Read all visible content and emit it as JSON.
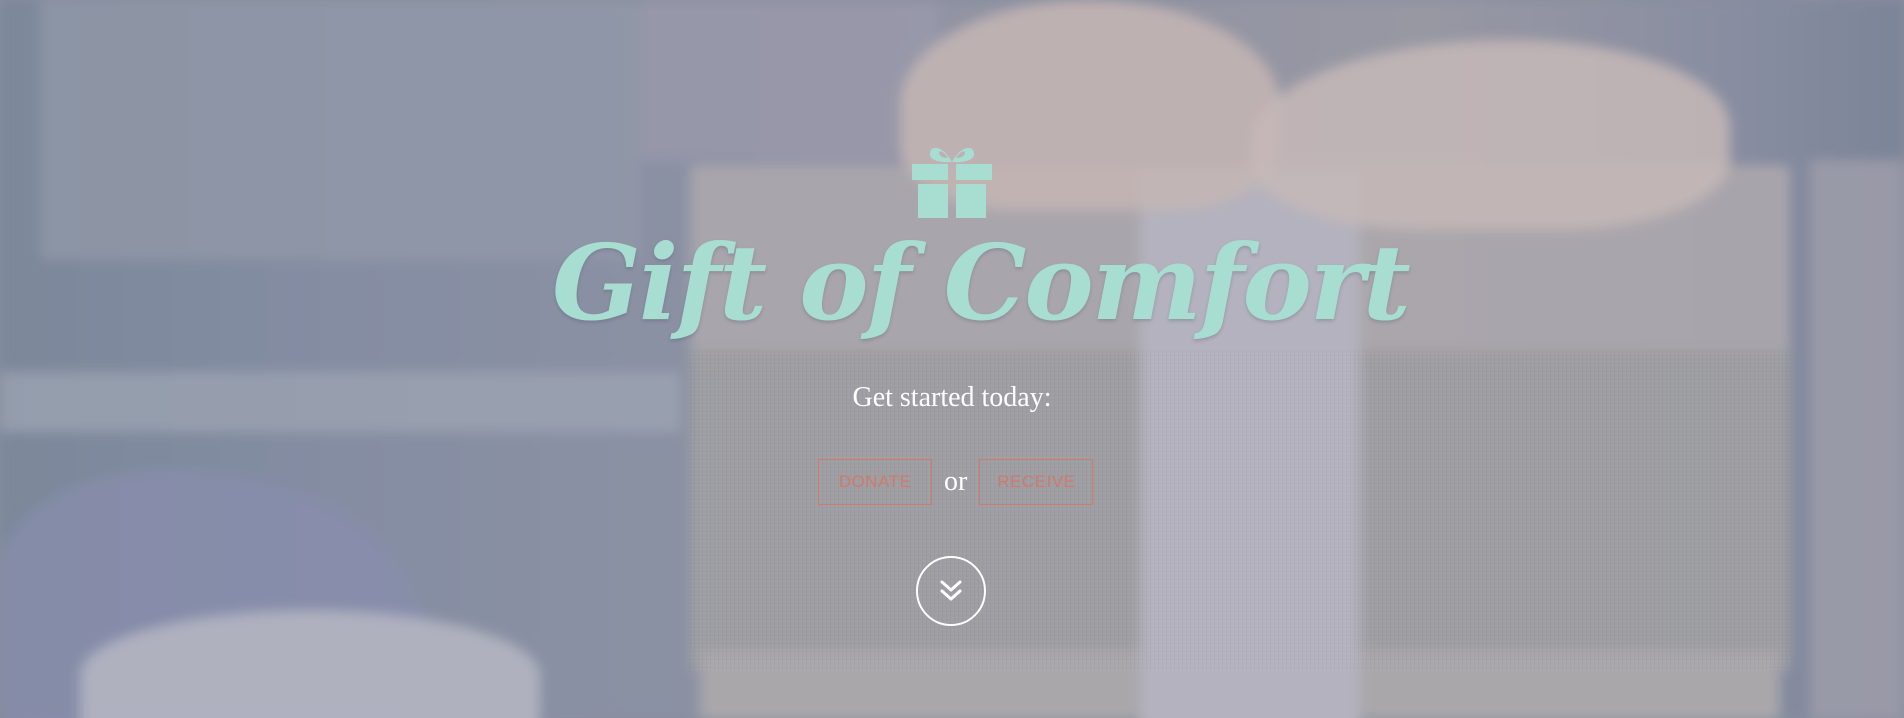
{
  "hero": {
    "title": "Gift of Comfort",
    "subtitle": "Get started today:",
    "donate_label": "DONATE",
    "or_text": "or",
    "receive_label": "RECEIVE"
  },
  "icons": {
    "brand": "gift-icon",
    "scroll": "double-chevron-down-icon"
  },
  "colors": {
    "title": "#a8ddd2",
    "button_accent": "#d07a6c",
    "text_light": "#ffffff"
  }
}
